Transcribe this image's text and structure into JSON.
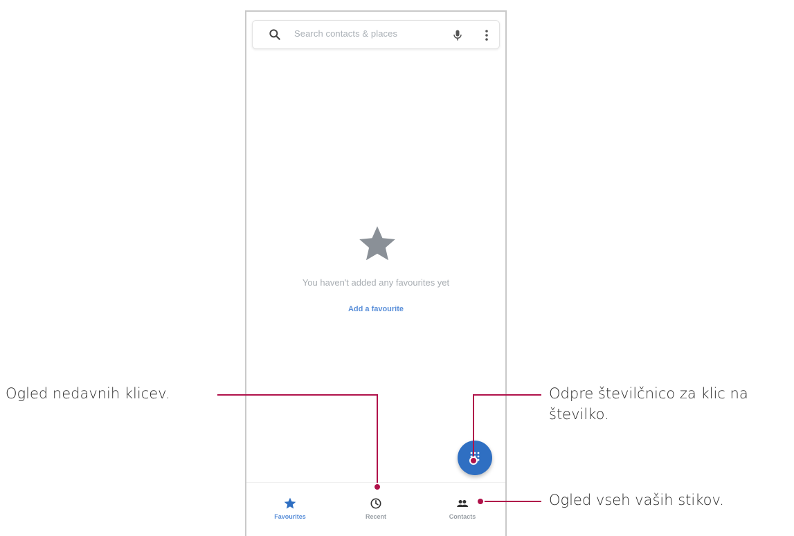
{
  "search": {
    "placeholder": "Search contacts & places"
  },
  "empty_state": {
    "message": "You haven't added any favourites yet",
    "action_label": "Add a favourite"
  },
  "bottom_nav": {
    "items": [
      {
        "label": "Favourites",
        "icon": "star-icon",
        "selected": true
      },
      {
        "label": "Recent",
        "icon": "clock-icon",
        "selected": false
      },
      {
        "label": "Contacts",
        "icon": "people-icon",
        "selected": false
      }
    ]
  },
  "callouts": {
    "recent": "Ogled nedavnih klicev.",
    "dialpad_line1": "Odpre številčnico za klic na",
    "dialpad_line2": "številko.",
    "contacts": "Ogled vseh vaših stikov."
  },
  "colors": {
    "accent": "#2f6fc2",
    "link": "#5a8fd9",
    "callout_line": "#b0124a",
    "star_gray": "#8a9097"
  }
}
